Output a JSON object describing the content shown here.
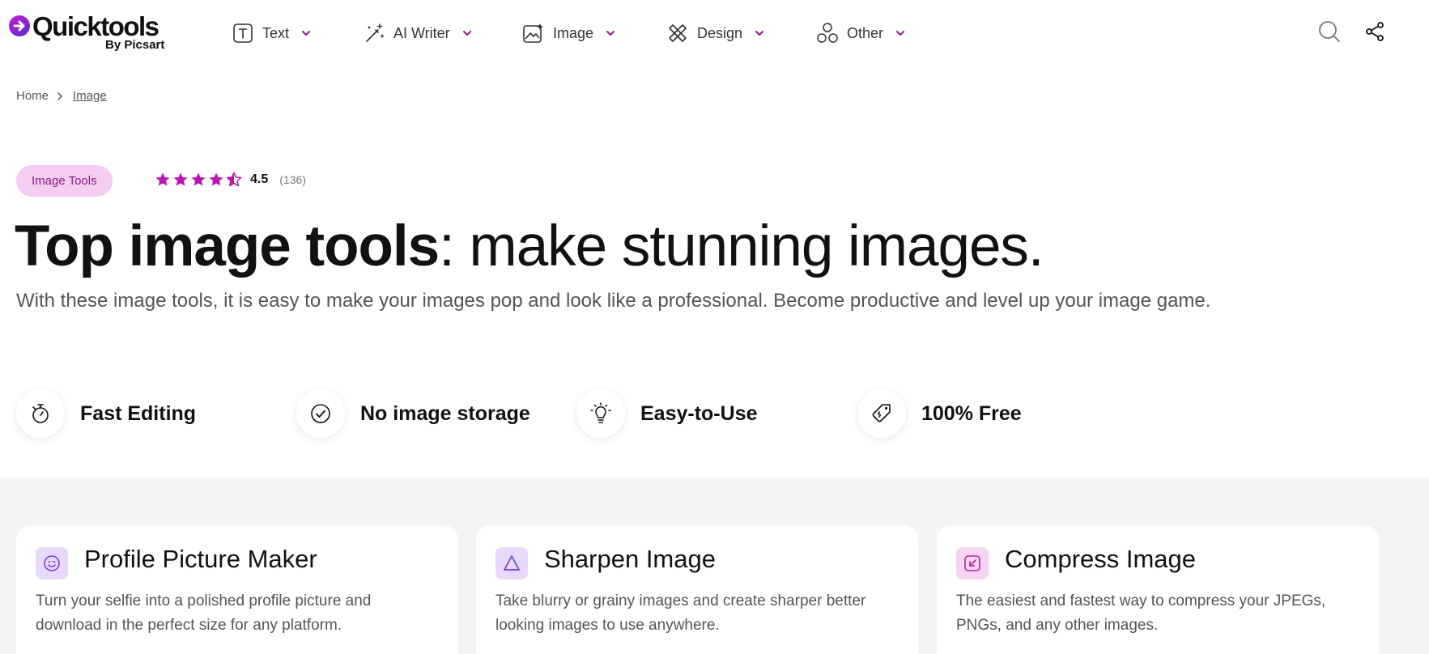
{
  "brand": {
    "name": "Quicktools",
    "byline": "By Picsart"
  },
  "nav": {
    "items": [
      {
        "label": "Text",
        "icon": "text-box-icon"
      },
      {
        "label": "AI Writer",
        "icon": "magic-wand-icon"
      },
      {
        "label": "Image",
        "icon": "image-sparkle-icon"
      },
      {
        "label": "Design",
        "icon": "ruler-pencil-icon"
      },
      {
        "label": "Other",
        "icon": "three-circles-icon"
      }
    ],
    "search_icon": "search-icon",
    "share_icon": "share-icon"
  },
  "breadcrumb": {
    "home": "Home",
    "current": "Image"
  },
  "hero": {
    "tag": "Image Tools",
    "rating": {
      "stars": 4.5,
      "value": "4.5",
      "count": "(136)"
    },
    "title_bold": "Top image tools",
    "title_rest": ": make stunning images.",
    "subtitle": "With these image tools, it is easy to make your images pop and look like a professional. Become productive and level up your image game."
  },
  "features": [
    {
      "label": "Fast Editing",
      "icon": "stopwatch-icon"
    },
    {
      "label": "No image storage",
      "icon": "check-circle-icon"
    },
    {
      "label": "Easy-to-Use",
      "icon": "lightbulb-icon"
    },
    {
      "label": "100% Free",
      "icon": "price-tag-icon"
    }
  ],
  "cards": [
    {
      "title": "Profile Picture Maker",
      "description": "Turn your selfie into a polished profile picture and download in the perfect size for any platform.",
      "icon": "smiley-icon",
      "icon_bg": "#e7d9fb",
      "icon_color": "#7b3fd9"
    },
    {
      "title": "Sharpen Image",
      "description": "Take blurry or grainy images and create sharper better looking images to use anywhere.",
      "icon": "triangle-icon",
      "icon_bg": "#e7d9fb",
      "icon_color": "#7b3fd9"
    },
    {
      "title": "Compress Image",
      "description": "The easiest and fastest way to compress your JPEGs, PNGs, and any other images.",
      "icon": "compress-arrow-icon",
      "icon_bg": "#f7d4f2",
      "icon_color": "#b3279f"
    }
  ],
  "colors": {
    "accent": "#c013b5",
    "tag_bg": "#f4cdf0",
    "section_bg": "#f4f4f4"
  }
}
